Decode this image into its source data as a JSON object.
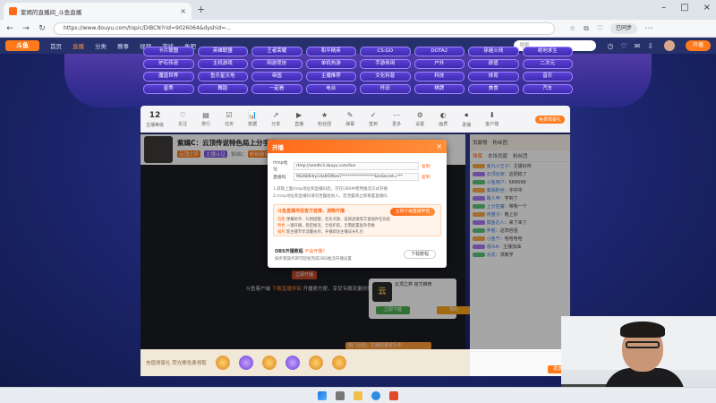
{
  "browser": {
    "tab_title": "紫嫣的直播间_斗鱼直播",
    "url": "https://www.douyu.com/topic/DIBCN?rid=9026064&dyshid=...",
    "profile": "已同步"
  },
  "site": {
    "logo": "斗鱼",
    "nav": [
      "首页",
      "直播",
      "分类",
      "赛事",
      "视频",
      "游戏",
      "鱼吧"
    ],
    "search_placeholder": "搜索",
    "login": "开播"
  },
  "tags": [
    "卡片联盟",
    "英雄联盟",
    "王者荣耀",
    "和平精英",
    "CS:GO",
    "DOTA2",
    "穿越火线",
    "绝地求生",
    "炉石传说",
    "主机游戏",
    "网游竞技",
    "单机热游",
    "手游休闲",
    "户外",
    "颜值",
    "二次元",
    "魔兽世界",
    "鱼乐星天地",
    "帝国",
    "主播推荐",
    "文化科普",
    "科技",
    "体育",
    "音乐",
    "星秀",
    "舞蹈",
    "一起看",
    "电台",
    "怀旧",
    "棋牌",
    "美食",
    "汽车"
  ],
  "roombar": {
    "level": "12",
    "level_label": "主播等级",
    "items": [
      "关注",
      "排行",
      "任务",
      "数据",
      "分享",
      "直播",
      "粉丝团",
      "弹幕",
      "签到",
      "更多",
      "设置",
      "画质",
      "录播",
      "客户端"
    ],
    "promo": "免费领豪礼"
  },
  "room": {
    "title": "紫嫣C：云顶传说特色局上分手法一",
    "streamer": "紫嫣C",
    "tag1": "云顶之弈",
    "tag2": "主播认证",
    "tag3": "粉丝勋章"
  },
  "dialog": {
    "title": "开播",
    "server_label": "rtmp地址",
    "server_value": "rtmp://sendtc3.douyu.com/live",
    "key_label": "直播码",
    "key_value": "9026064rp14a6f3f6ee7*****************&txSecret=***",
    "copy": "复制",
    "note1": "1.获取上面rtmp地址和直播码后，可在OBS中使用推流方式开播",
    "note2": "2.rtmp地址和直播码请勿泄露给他人，若泄露请立即重置直播码",
    "box_title": "斗鱼直播伴侣官方首推，流畅开播",
    "box_button": "立刻下载直播伴侣",
    "box_lines": [
      {
        "k": "功能",
        "v": "弹幕助手、礼物提醒、音乐点歌、美颜滤镜等丰富插件任你选"
      },
      {
        "k": "特色",
        "v": "一键开播，稳定推流，全程护航，无需配置复杂参数"
      },
      {
        "k": "福利",
        "v": "新主播专享流量扶持，开播即送主播成长礼包"
      }
    ],
    "foot_title": "OBS开播教程",
    "foot_tag": "不会开播？",
    "foot_sub": "按步骤操作即可轻松完成OBS推流开播设置",
    "download": "下载教程"
  },
  "video": {
    "message_prefix": "斗鱼客户端",
    "message_link": "下载直播伴侣",
    "message_suffix": "开播更方便，享受专属流量扶持",
    "button": "立即开播"
  },
  "gamecard": {
    "logo": "云",
    "title": "云顶之弈·官方推荐",
    "btn1": "立即下载",
    "btn2": "预约"
  },
  "promo_strip": "热门活动：主播招募进行中",
  "giftbar": {
    "text": "充值得豪礼  荧光棒免费领取"
  },
  "chat": {
    "head_rank": "贡献榜",
    "head_fans": "粉丝团",
    "tabs": [
      "弹幕",
      "本场贡献",
      "粉丝团"
    ],
    "lines": [
      {
        "u": "鱼丸小王子",
        "t": "主播好帅"
      },
      {
        "u": "云顶玩家",
        "t": "这把稳了"
      },
      {
        "u": "斗鱼用户",
        "t": "666666"
      },
      {
        "u": "紫嫣粉丝",
        "t": "冲冲冲"
      },
      {
        "u": "路人甲",
        "t": "学到了"
      },
      {
        "u": "上分狂魔",
        "t": "带我一个"
      },
      {
        "u": "夜猫子",
        "t": "晚上好"
      },
      {
        "u": "摸鱼达人",
        "t": "来了来了"
      },
      {
        "u": "弈者",
        "t": "这阵容强"
      },
      {
        "u": "小鱼干",
        "t": "哈哈哈哈"
      },
      {
        "u": "观众A",
        "t": "主播加油"
      },
      {
        "u": "水友",
        "t": "求教学"
      }
    ],
    "send": "发送"
  }
}
